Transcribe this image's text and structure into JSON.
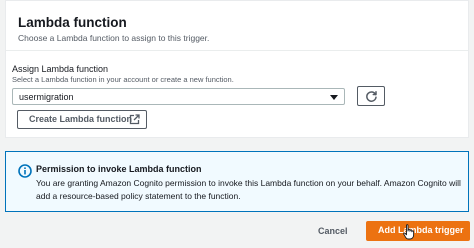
{
  "panel": {
    "title": "Lambda function",
    "description": "Choose a Lambda function to assign to this trigger.",
    "field_label": "Assign Lambda function",
    "field_description": "Select a Lambda function in your account or create a new function.",
    "selected_function": "usermigration",
    "create_button_label": "Create Lambda function"
  },
  "info": {
    "title": "Permission to invoke Lambda function",
    "body": "You are granting Amazon Cognito permission to invoke this Lambda function on your behalf. Amazon Cognito will add a resource-based policy statement to the function."
  },
  "footer": {
    "cancel_label": "Cancel",
    "add_label": "Add Lambda trigger"
  },
  "icons": {
    "caret": "caret-down-icon",
    "refresh": "refresh-icon",
    "external": "external-link-icon",
    "info": "info-icon",
    "cursor": "hand-cursor-icon"
  },
  "colors": {
    "primary_button": "#ec7211",
    "info_border": "#0073bb",
    "info_background": "#f1faff",
    "page_background": "#f2f3f3"
  }
}
